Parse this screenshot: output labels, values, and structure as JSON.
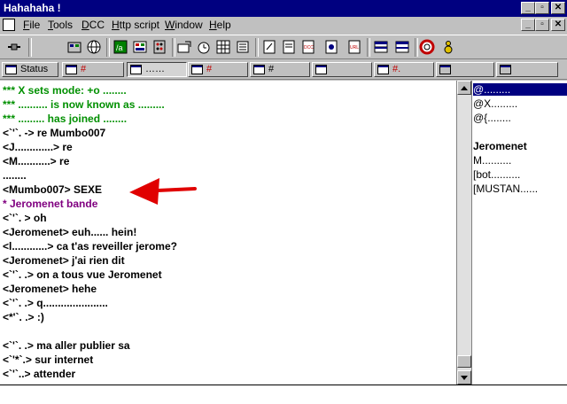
{
  "window": {
    "title": "Hahahaha !"
  },
  "menu": {
    "items": [
      {
        "label": "File"
      },
      {
        "label": "Tools"
      },
      {
        "label": "DCC"
      },
      {
        "label": "Http script"
      },
      {
        "label": "Window"
      },
      {
        "label": "Help"
      }
    ]
  },
  "switchbar": {
    "tabs": [
      {
        "label": "Status"
      },
      {
        "label": "#"
      },
      {
        "label": "……"
      },
      {
        "label": "#"
      },
      {
        "label": "#"
      },
      {
        "label": ""
      },
      {
        "label": "#."
      },
      {
        "label": ""
      },
      {
        "label": ""
      }
    ]
  },
  "chat": {
    "lines": [
      {
        "text": "*** X sets mode: +o ........",
        "style": "green"
      },
      {
        "text": "*** .......... is now known as .........",
        "style": "green"
      },
      {
        "text": "*** ......... has joined ........",
        "style": "green"
      },
      {
        "text": "<`'`. -> re Mumbo007",
        "style": "norm"
      },
      {
        "text": "<J.............> re",
        "style": "norm"
      },
      {
        "text": "<M...........> re",
        "style": "norm"
      },
      {
        "text": "........",
        "style": "norm"
      },
      {
        "text": "<Mumbo007> SEXE",
        "style": "norm"
      },
      {
        "text": "* Jeromenet bande",
        "style": "purple"
      },
      {
        "text": "<`'`. > oh",
        "style": "norm"
      },
      {
        "text": "<Jeromenet> euh...... hein!",
        "style": "norm"
      },
      {
        "text": "<l............> ca t'as reveiller jerome?",
        "style": "norm"
      },
      {
        "text": "<Jeromenet> j'ai rien dit",
        "style": "norm"
      },
      {
        "text": "<`'`. .> on a tous vue Jeromenet",
        "style": "norm"
      },
      {
        "text": "<Jeromenet> hehe",
        "style": "norm"
      },
      {
        "text": "<`'`. .> q......................",
        "style": "norm"
      },
      {
        "text": "<*'`. .> :)",
        "style": "norm"
      },
      {
        "text": "",
        "style": "norm"
      },
      {
        "text": "<`'`. .> ma aller publier sa",
        "style": "norm"
      },
      {
        "text": "<`'*`.> sur internet",
        "style": "norm"
      },
      {
        "text": "<`'`..> attender",
        "style": "norm"
      }
    ]
  },
  "nicklist": {
    "nicks": [
      {
        "text": "@.........",
        "selected": true
      },
      {
        "text": "@X.........",
        "selected": false
      },
      {
        "text": "@{........",
        "selected": false
      },
      {
        "text": "",
        "selected": false
      },
      {
        "text": "Jeromenet",
        "selected": false
      },
      {
        "text": "M..........",
        "selected": false
      },
      {
        "text": "[bot..........",
        "selected": false
      },
      {
        "text": "[MUSTAN......",
        "selected": false
      }
    ]
  },
  "editbox": {
    "value": ""
  },
  "colors": {
    "titlebar": "#000080",
    "join_text": "#009000",
    "action_text": "#800080",
    "arrow": "#e00000"
  },
  "toolbar": {
    "icons": [
      "connect-icon",
      "options-icon",
      "address-book-icon",
      "channels-icon",
      "scripts-icon",
      "remote-icon",
      "aliases-icon",
      "dcc-send-icon",
      "dcc-chat-icon",
      "timer-icon",
      "colors-icon",
      "notify-icon",
      "log-icon",
      "url-icon",
      "dcc-list-icon",
      "list-icon",
      "tile-icon",
      "cascade-icon",
      "help-icon",
      "about-icon"
    ]
  }
}
